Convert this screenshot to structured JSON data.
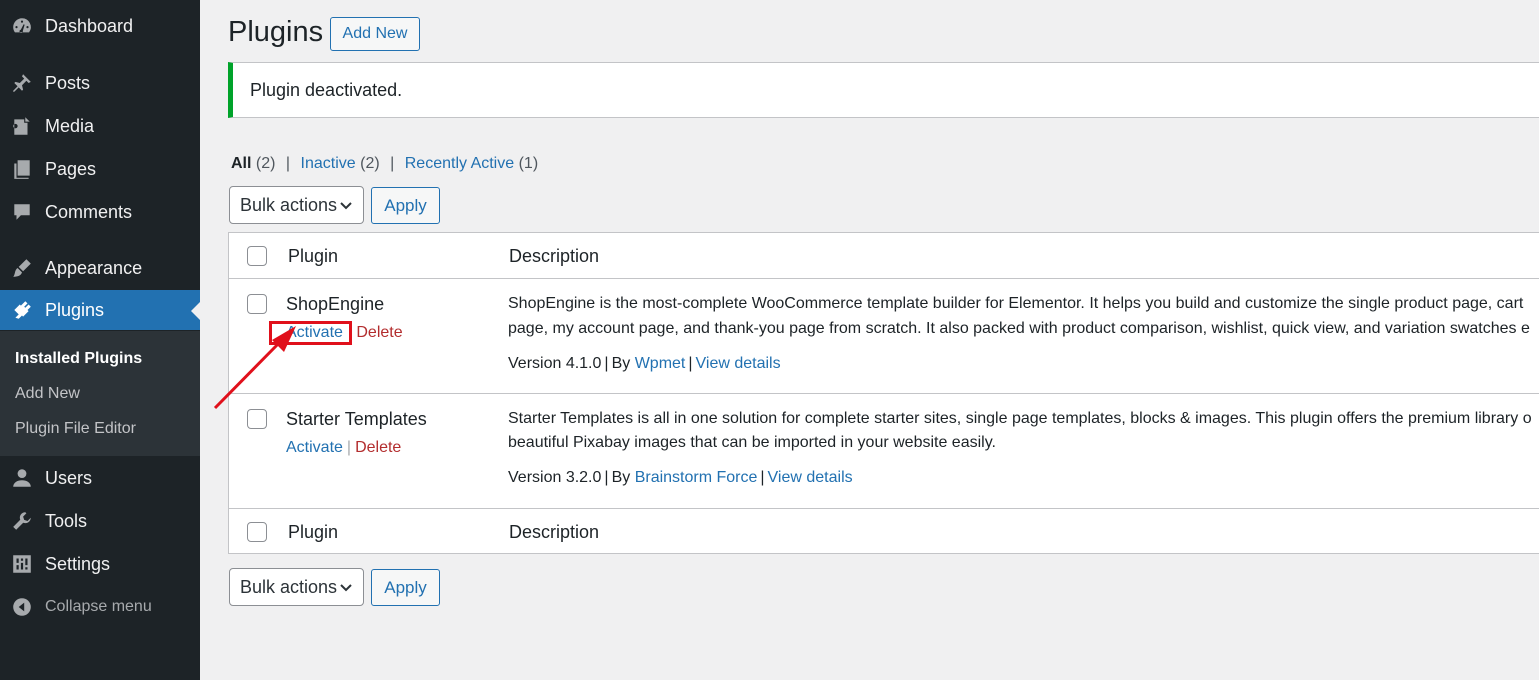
{
  "sidebar": {
    "items": [
      {
        "label": "Dashboard",
        "icon": "dashboard-icon"
      },
      {
        "label": "Posts",
        "icon": "pin-icon"
      },
      {
        "label": "Media",
        "icon": "media-icon"
      },
      {
        "label": "Pages",
        "icon": "pages-icon"
      },
      {
        "label": "Comments",
        "icon": "comment-icon"
      },
      {
        "label": "Appearance",
        "icon": "brush-icon"
      },
      {
        "label": "Plugins",
        "icon": "plugin-icon"
      },
      {
        "label": "Users",
        "icon": "user-icon"
      },
      {
        "label": "Tools",
        "icon": "wrench-icon"
      },
      {
        "label": "Settings",
        "icon": "settings-icon"
      },
      {
        "label": "Collapse menu",
        "icon": "collapse-icon"
      }
    ],
    "submenu": [
      "Installed Plugins",
      "Add New",
      "Plugin File Editor"
    ]
  },
  "header": {
    "title": "Plugins",
    "add_new": "Add New"
  },
  "notice": "Plugin deactivated.",
  "filters": {
    "all": "All",
    "all_count": "(2)",
    "inactive": "Inactive",
    "inactive_count": "(2)",
    "recent": "Recently Active",
    "recent_count": "(1)",
    "sep": "|"
  },
  "bulk": {
    "label": "Bulk actions",
    "apply": "Apply"
  },
  "table": {
    "col_plugin": "Plugin",
    "col_description": "Description",
    "rows": [
      {
        "name": "ShopEngine",
        "activate": "Activate",
        "delete": "Delete",
        "desc1": "ShopEngine is the most-complete WooCommerce template builder for Elementor. It helps you build and customize the single product page, cart",
        "desc2": "page, my account page, and thank-you page from scratch. It also packed with product comparison, wishlist, quick view, and variation swatches e",
        "version": "Version 4.1.0",
        "by": "By",
        "author": "Wpmet",
        "view": "View details"
      },
      {
        "name": "Starter Templates",
        "activate": "Activate",
        "sep": "|",
        "delete": "Delete",
        "desc1": "Starter Templates is all in one solution for complete starter sites, single page templates, blocks & images. This plugin offers the premium library o",
        "desc2": "beautiful Pixabay images that can be imported in your website easily.",
        "version": "Version 3.2.0",
        "by": "By",
        "author": "Brainstorm Force",
        "view": "View details"
      }
    ]
  },
  "colors": {
    "sidebar": "#1d2327",
    "accent": "#2271b1",
    "notice": "#00a32a",
    "annotation": "#e0101b",
    "delete": "#b32d2e"
  }
}
